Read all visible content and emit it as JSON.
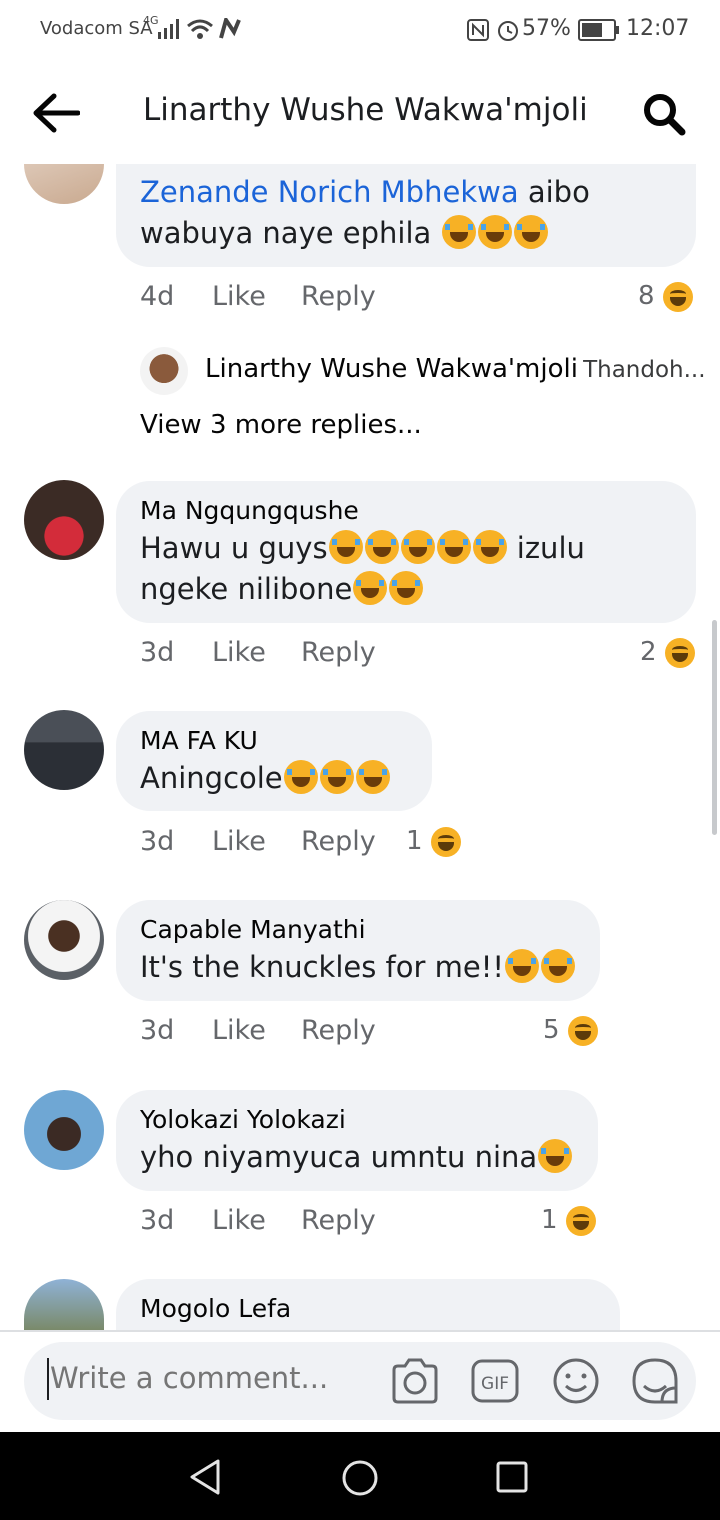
{
  "status_bar": {
    "carrier": "Vodacom SA",
    "network": "4G",
    "battery": "57%",
    "time": "12:07"
  },
  "header": {
    "title": "Linarthy Wushe Wakwa'mjoli"
  },
  "top_comment": {
    "mention": "Zenande Norich Mbhekwa",
    "text_line1": " aibo",
    "text_line2": "wabuya naye ephila",
    "time": "4d",
    "like": "Like",
    "reply": "Reply",
    "reaction_count": "8"
  },
  "reply_preview": {
    "name": "Linarthy Wushe Wakwa'mjoli",
    "snippet": "Thandoh..."
  },
  "view_more": "View 3 more replies...",
  "comments": [
    {
      "name": "Ma Ngqungqushe",
      "line1": "Hawu u guys",
      "line1b": " izulu",
      "line2": "ngeke nilibone",
      "time": "3d",
      "like": "Like",
      "reply": "Reply",
      "reaction_count": "2"
    },
    {
      "name": "MA FA KU",
      "line1": "Aningcole",
      "time": "3d",
      "like": "Like",
      "reply": "Reply",
      "reaction_count": "1"
    },
    {
      "name": "Capable Manyathi",
      "line1": "It's the knuckles for me!!",
      "time": "3d",
      "like": "Like",
      "reply": "Reply",
      "reaction_count": "5"
    },
    {
      "name": "Yolokazi Yolokazi",
      "line1": "yho niyamyuca umntu nina",
      "time": "3d",
      "like": "Like",
      "reply": "Reply",
      "reaction_count": "1"
    },
    {
      "name": "Mogolo Lefa"
    }
  ],
  "composer": {
    "placeholder": "Write a comment..."
  },
  "colors": {
    "bubble": "#f0f2f5",
    "link": "#1b64d8",
    "meta": "#65676b",
    "reaction": "#f7b125"
  },
  "icons": [
    "back-arrow-icon",
    "search-icon",
    "camera-icon",
    "gif-icon",
    "emoji-icon",
    "sticker-icon",
    "nav-back-icon",
    "nav-home-icon",
    "nav-recents-icon"
  ]
}
